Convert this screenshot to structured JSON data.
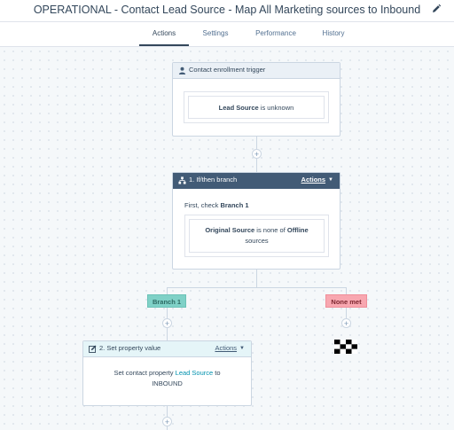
{
  "header": {
    "title": "OPERATIONAL - Contact Lead Source - Map All Marketing sources to Inbound",
    "edit_icon": "pencil-icon"
  },
  "tabs": [
    {
      "label": "Actions",
      "active": true
    },
    {
      "label": "Settings",
      "active": false
    },
    {
      "label": "Performance",
      "active": false
    },
    {
      "label": "History",
      "active": false
    }
  ],
  "trigger": {
    "title": "Contact enrollment trigger",
    "icon": "person-icon",
    "condition": {
      "property": "Lead Source",
      "text": "is unknown"
    }
  },
  "branch_card": {
    "title": "1. If/then branch",
    "icon": "branch-icon",
    "actions_label": "Actions",
    "check_prefix": "First, check",
    "check_branch": "Branch 1",
    "condition": {
      "property": "Original Source",
      "operator": "is none of",
      "value_bold": "Offline",
      "value_rest": "sources"
    }
  },
  "branches": {
    "branch1_label": "Branch 1",
    "none_met_label": "None met"
  },
  "action_card": {
    "title": "2. Set property value",
    "icon": "edit-property-icon",
    "actions_label": "Actions",
    "line1_prefix": "Set contact property",
    "line1_property": "Lead Source",
    "line1_suffix": "to",
    "line2": "INBOUND"
  },
  "plus_symbol": "+",
  "colors": {
    "branch_header": "#425b76",
    "branch_badge": "#7fd1c7",
    "none_met_badge": "#f8a7b0",
    "link": "#0091ae"
  }
}
